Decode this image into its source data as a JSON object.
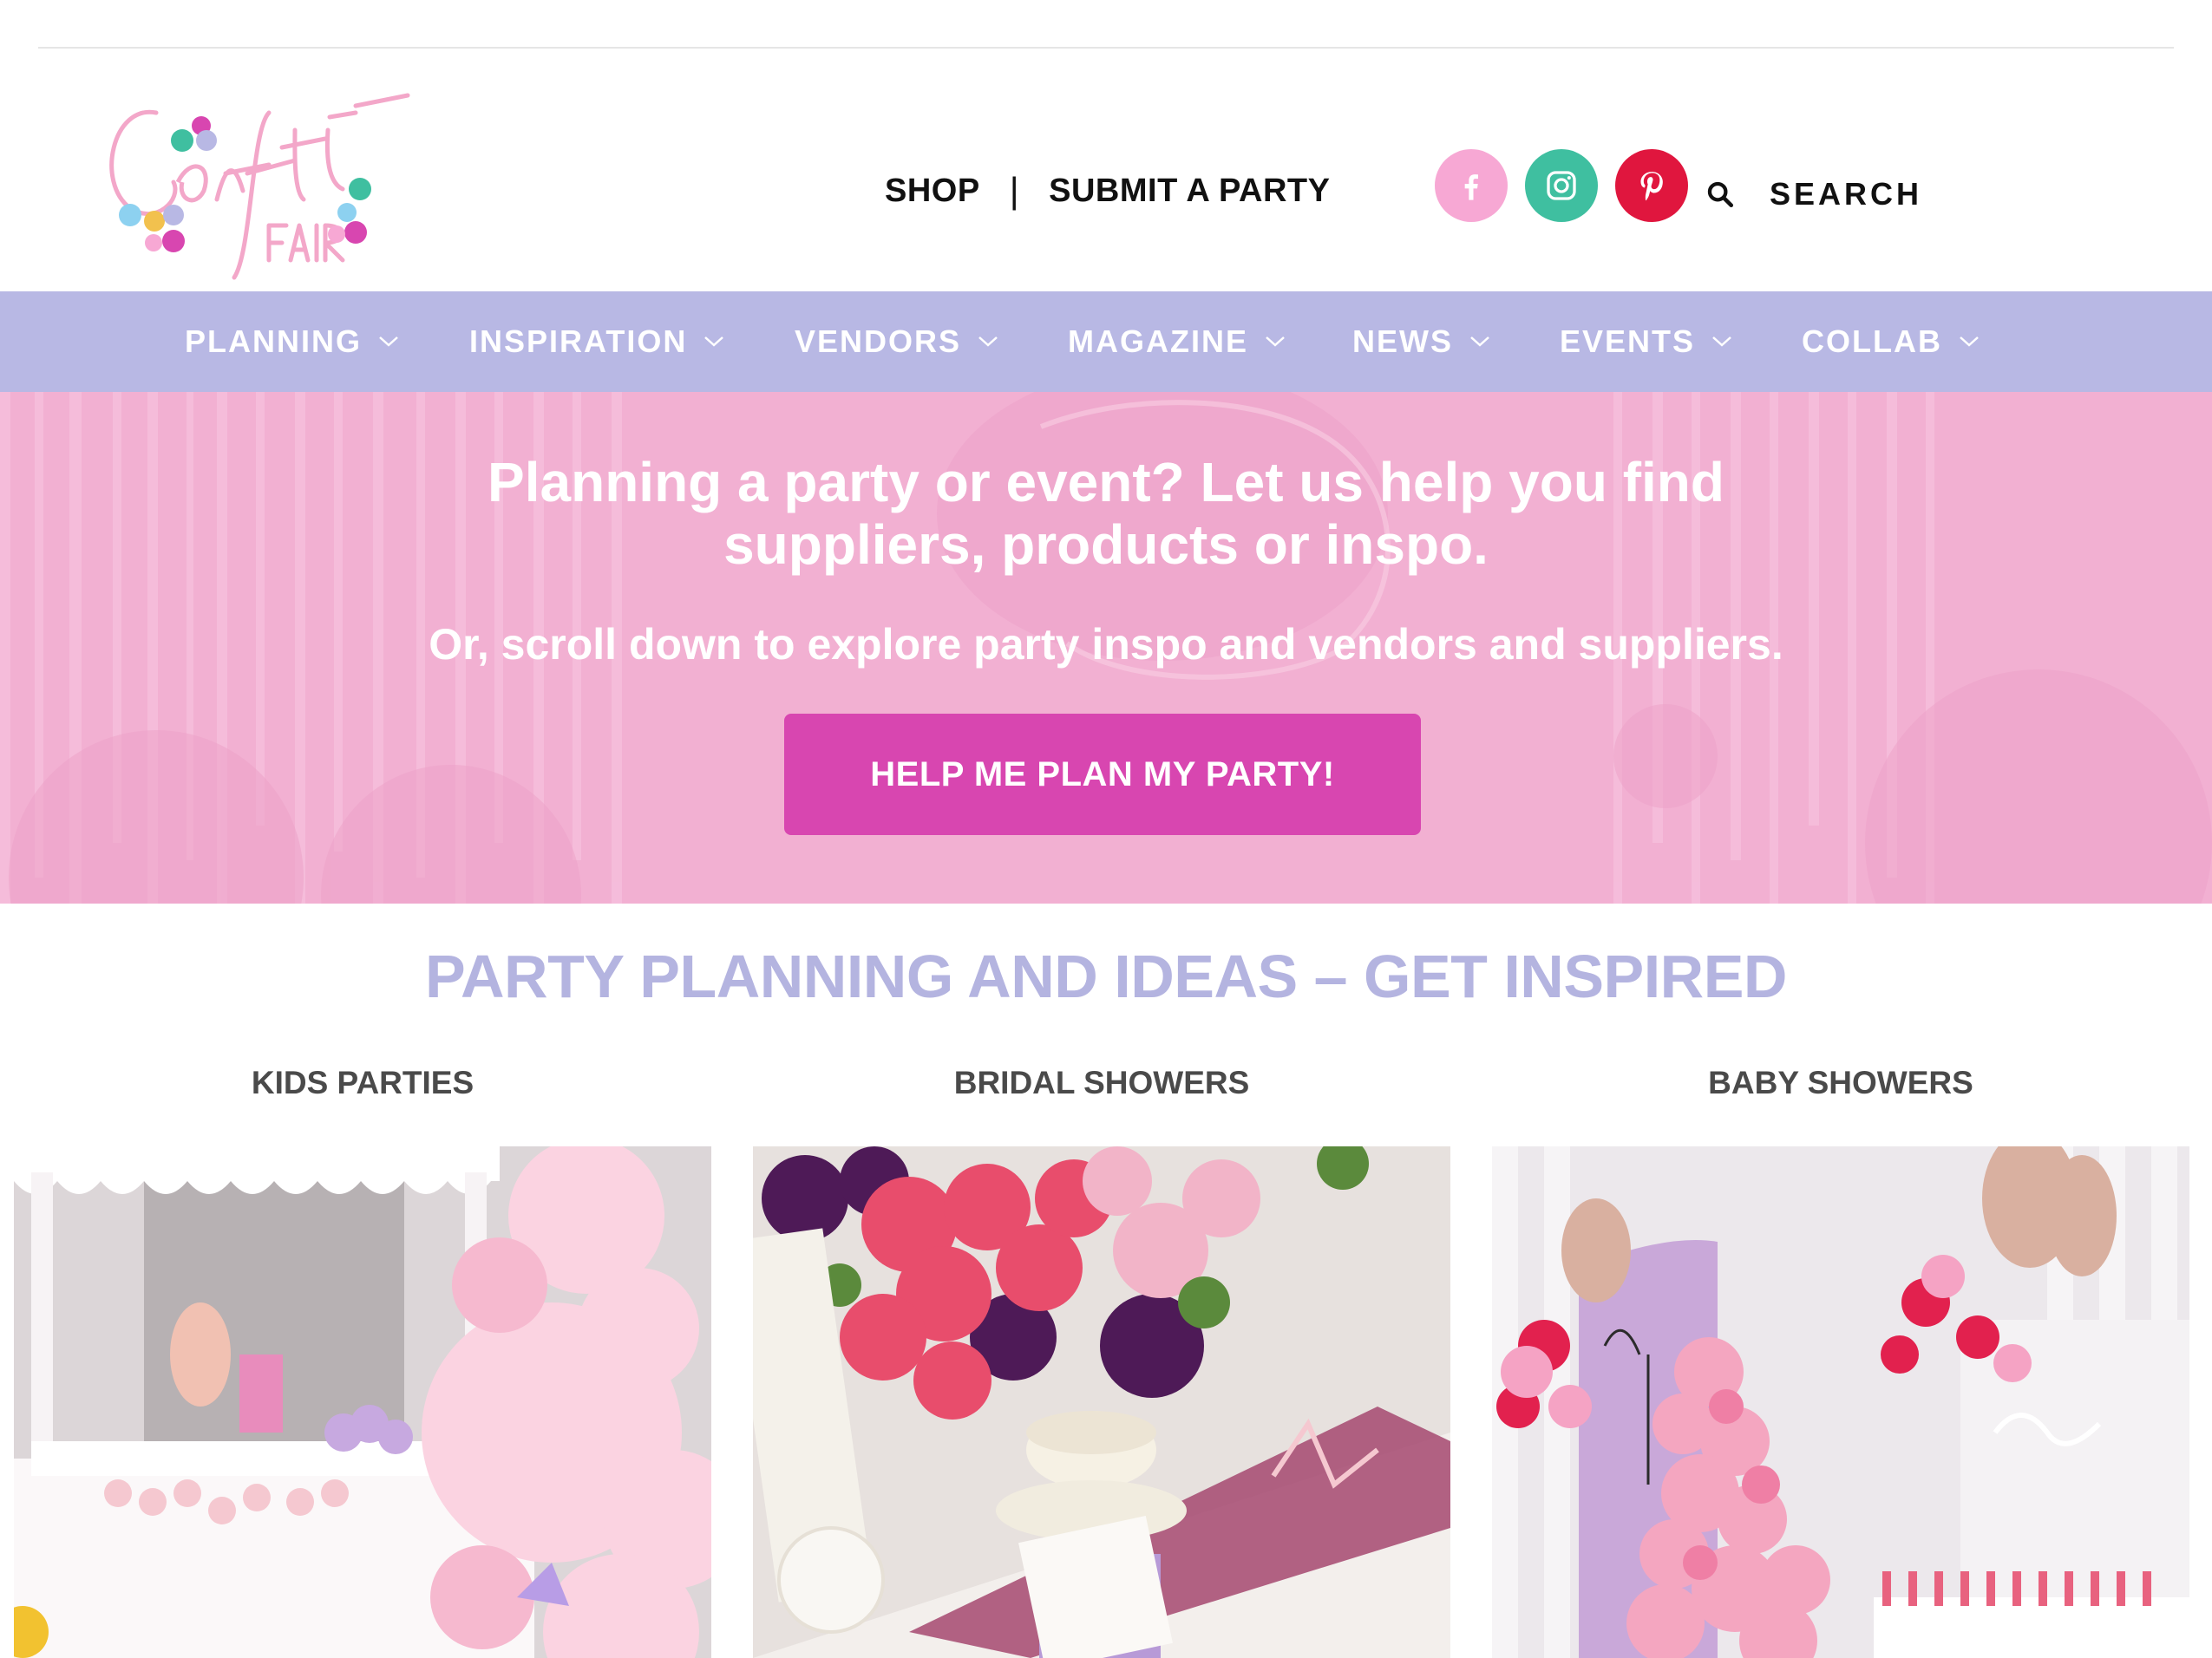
{
  "brand": {
    "logo_name": "Confetti Fair",
    "colors": {
      "pink": "#f7a8d4",
      "lavender": "#b8b8e4",
      "magenta": "#d846b0",
      "teal": "#3fbfa0",
      "red": "#e0163e"
    }
  },
  "header": {
    "util_nav": {
      "shop": "SHOP",
      "separator": "|",
      "submit": "SUBMIT A PARTY"
    },
    "social": [
      {
        "name": "facebook",
        "icon": "facebook-icon"
      },
      {
        "name": "instagram",
        "icon": "instagram-icon"
      },
      {
        "name": "pinterest",
        "icon": "pinterest-icon"
      }
    ],
    "search": {
      "icon": "search-icon",
      "placeholder": "SEARCH",
      "value": ""
    }
  },
  "main_nav": {
    "items": [
      {
        "label": "PLANNING",
        "icon": "chevron-down-icon"
      },
      {
        "label": "INSPIRATION",
        "icon": "chevron-down-icon"
      },
      {
        "label": "VENDORS",
        "icon": "chevron-down-icon"
      },
      {
        "label": "MAGAZINE",
        "icon": "chevron-down-icon"
      },
      {
        "label": "NEWS",
        "icon": "chevron-down-icon"
      },
      {
        "label": "EVENTS",
        "icon": "chevron-down-icon"
      },
      {
        "label": "COLLAB",
        "icon": "chevron-down-icon"
      }
    ]
  },
  "hero": {
    "title_line1": "Planning a party or event? Let us help you find",
    "title_line2": "suppliers, products or inspo.",
    "subtitle": "Or, scroll down to explore party inspo and vendors and suppliers.",
    "button": "HELP ME PLAN MY PARTY!"
  },
  "inspiration": {
    "title": "PARTY PLANNING AND IDEAS – GET INSPIRED",
    "categories": [
      {
        "title": "KIDS PARTIES"
      },
      {
        "title": "BRIDAL SHOWERS"
      },
      {
        "title": "BABY SHOWERS"
      }
    ]
  }
}
